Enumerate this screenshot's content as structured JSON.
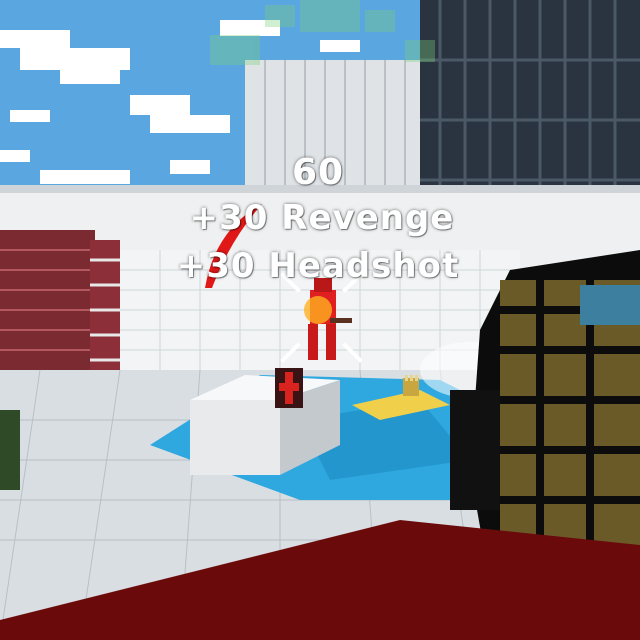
{
  "hud": {
    "score_total": "60",
    "bonus_revenge": "+30 Revenge",
    "bonus_headshot": "+30 Headshot"
  },
  "icons": {
    "damage_indicator": "red-arc-direction-icon",
    "hitmarker": "crosshair-hitmarker-icon",
    "health_pickup": "red-cross-icon",
    "ammo_pickup": "ammo-crate-icon"
  },
  "colors": {
    "sky": "#5aa6e0",
    "water": "#2fa8e0",
    "building": "#2a3440",
    "brick_stripe": "#8a2a35",
    "enemy": "#e02020",
    "weapon_gold": "#7a6a30",
    "foreground_red": "#6b0a0a"
  }
}
